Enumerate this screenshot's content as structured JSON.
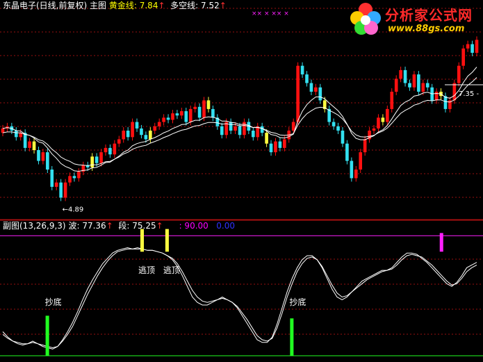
{
  "main_header": {
    "software": "东晶电子(日线,前复权)",
    "panel": "主图",
    "gold_label": "黄金线:",
    "gold_value": "7.84",
    "long_label": "多空线:",
    "long_value": "7.52",
    "arrow": "↑"
  },
  "sub_header": {
    "label": "副图(13,26,9,3)",
    "wave_label": "波:",
    "wave_value": "77.36",
    "seg_label": "段:",
    "seg_value": "75.25",
    "level_value": ": 90.00",
    "zero_value": "0.00",
    "arrow": "↑"
  },
  "logo": {
    "title": "分析家公式网",
    "url": "www.88gs.com"
  },
  "colors": {
    "up": "#ff1010",
    "down": "#33e0f0",
    "warn": "#ffff40",
    "ma": "#ffffff",
    "grid": "#9a1010",
    "level": "#ff20ff",
    "bottom": "#20ff20"
  },
  "chart_data": [
    {
      "type": "candlestick",
      "panel": "main",
      "annotations": {
        "low_label": "←4.89",
        "price_label": "7.35 -",
        "top_marks": "×× × ×× ×"
      },
      "close": [
        6.55,
        6.6,
        6.5,
        6.35,
        6.45,
        6.1,
        6.25,
        6.05,
        5.8,
        6.0,
        5.6,
        5.2,
        5.3,
        4.95,
        5.3,
        5.45,
        5.4,
        5.55,
        5.7,
        5.65,
        5.9,
        5.75,
        6.0,
        6.1,
        5.95,
        6.2,
        6.3,
        6.5,
        6.35,
        6.7,
        6.55,
        6.4,
        6.3,
        6.5,
        6.6,
        6.7,
        6.8,
        6.75,
        6.9,
        6.85,
        6.95,
        6.7,
        7.0,
        7.05,
        6.8,
        7.2,
        7.0,
        6.8,
        6.6,
        6.4,
        6.7,
        6.5,
        6.6,
        6.4,
        6.7,
        6.5,
        6.35,
        6.6,
        6.45,
        6.2,
        6.0,
        6.25,
        6.1,
        6.3,
        6.5,
        6.7,
        8.0,
        7.8,
        7.6,
        7.4,
        7.5,
        7.2,
        7.0,
        6.7,
        6.6,
        6.5,
        6.2,
        5.8,
        5.4,
        5.6,
        6.0,
        6.3,
        6.5,
        6.55,
        6.8,
        6.7,
        7.0,
        7.4,
        7.7,
        7.9,
        7.6,
        7.5,
        7.8,
        7.4,
        7.6,
        7.5,
        7.2,
        7.4,
        7.3,
        7.0,
        7.2,
        7.6,
        8.0,
        8.4,
        8.5,
        8.3,
        8.6
      ],
      "ma_fast": [
        6.55,
        6.57,
        6.55,
        6.5,
        6.49,
        6.42,
        6.39,
        6.33,
        6.24,
        6.21,
        6.1,
        5.96,
        5.86,
        5.74,
        5.67,
        5.63,
        5.57,
        5.56,
        5.58,
        5.59,
        5.64,
        5.65,
        5.7,
        5.76,
        5.77,
        5.84,
        5.91,
        6.0,
        6.05,
        6.15,
        6.2,
        6.23,
        6.25,
        6.3,
        6.34,
        6.39,
        6.45,
        6.49,
        6.55,
        6.59,
        6.64,
        6.65,
        6.7,
        6.74,
        6.74,
        6.8,
        6.82,
        6.81,
        6.78,
        6.72,
        6.72,
        6.69,
        6.68,
        6.64,
        6.65,
        6.62,
        6.57,
        6.58,
        6.55,
        6.49,
        6.41,
        6.39,
        6.34,
        6.33,
        6.36,
        6.42,
        6.73,
        6.95,
        7.1,
        7.2,
        7.28,
        7.28,
        7.24,
        7.14,
        7.05,
        6.96,
        6.83,
        6.65,
        6.44,
        6.32,
        6.29,
        6.29,
        6.34,
        6.38,
        6.47,
        6.52,
        6.62,
        6.77,
        6.93,
        7.08,
        7.16,
        7.21,
        7.3,
        7.32,
        7.37,
        7.39,
        7.35,
        7.36,
        7.35,
        7.27,
        7.25,
        7.31,
        7.43,
        7.61,
        7.76,
        7.85,
        7.97
      ],
      "ma_slow": [
        6.45,
        6.47,
        6.47,
        6.45,
        6.45,
        6.41,
        6.39,
        6.35,
        6.29,
        6.26,
        6.18,
        6.07,
        5.99,
        5.89,
        5.83,
        5.79,
        5.73,
        5.71,
        5.7,
        5.69,
        5.71,
        5.71,
        5.74,
        5.78,
        5.79,
        5.84,
        5.89,
        5.96,
        6.0,
        6.07,
        6.11,
        6.14,
        6.16,
        6.21,
        6.25,
        6.29,
        6.34,
        6.38,
        6.43,
        6.47,
        6.51,
        6.53,
        6.57,
        6.61,
        6.62,
        6.66,
        6.69,
        6.69,
        6.68,
        6.65,
        6.66,
        6.64,
        6.64,
        6.61,
        6.62,
        6.6,
        6.57,
        6.57,
        6.55,
        6.51,
        6.46,
        6.44,
        6.4,
        6.39,
        6.4,
        6.43,
        6.63,
        6.78,
        6.89,
        6.96,
        7.02,
        7.04,
        7.03,
        6.97,
        6.92,
        6.86,
        6.77,
        6.64,
        6.49,
        6.4,
        6.36,
        6.35,
        6.37,
        6.39,
        6.45,
        6.49,
        6.56,
        6.67,
        6.79,
        6.9,
        6.97,
        7.02,
        7.09,
        7.12,
        7.17,
        7.2,
        7.19,
        7.21,
        7.21,
        7.17,
        7.16,
        7.21,
        7.3,
        7.43,
        7.55,
        7.63,
        7.73
      ],
      "ylim": [
        4.7,
        9.2
      ]
    },
    {
      "type": "line",
      "panel": "sub",
      "series": [
        {
          "values": [
            18,
            14,
            11,
            9,
            8,
            9,
            11,
            9,
            7,
            6,
            5,
            7,
            12,
            18,
            25,
            33,
            42,
            50,
            57,
            63,
            69,
            73,
            77,
            79,
            80,
            81,
            80,
            81,
            80,
            79,
            79,
            78,
            77,
            75,
            72,
            67,
            60,
            52,
            44,
            40,
            38,
            38,
            40,
            42,
            44,
            42,
            40,
            36,
            30,
            24,
            18,
            12,
            10,
            10,
            14,
            24,
            36,
            48,
            58,
            66,
            72,
            75,
            75,
            72,
            66,
            58,
            50,
            44,
            42,
            44,
            48,
            52,
            56,
            58,
            60,
            62,
            64,
            64,
            66,
            70,
            74,
            77,
            77,
            76,
            73,
            70,
            66,
            62,
            58,
            54,
            52,
            55,
            60,
            66,
            68,
            70
          ]
        },
        {
          "values": [
            16,
            13,
            11,
            10,
            9,
            9,
            10,
            9,
            8,
            7,
            6,
            7,
            11,
            16,
            22,
            30,
            38,
            46,
            53,
            60,
            66,
            71,
            75,
            78,
            79,
            80,
            80,
            80,
            80,
            79,
            79,
            78,
            77,
            75,
            73,
            69,
            63,
            56,
            49,
            44,
            41,
            40,
            41,
            42,
            43,
            42,
            40,
            37,
            32,
            27,
            21,
            15,
            12,
            11,
            13,
            21,
            32,
            44,
            54,
            63,
            69,
            73,
            74,
            72,
            67,
            60,
            53,
            47,
            44,
            45,
            48,
            51,
            54,
            57,
            59,
            61,
            63,
            64,
            65,
            68,
            72,
            75,
            76,
            75,
            74,
            71,
            68,
            64,
            60,
            56,
            53,
            54,
            58,
            63,
            66,
            68
          ]
        }
      ],
      "signals": [
        {
          "type": "bottom",
          "label": "抄底",
          "index": 9
        },
        {
          "type": "top",
          "label": "逃顶",
          "index": 28
        },
        {
          "type": "top",
          "label": "逃顶",
          "index": 33
        },
        {
          "type": "bottom",
          "label": "抄底",
          "index": 58
        },
        {
          "type": "top",
          "label": "",
          "index": 88
        }
      ],
      "level": 90,
      "ylim": [
        0,
        100
      ]
    }
  ]
}
